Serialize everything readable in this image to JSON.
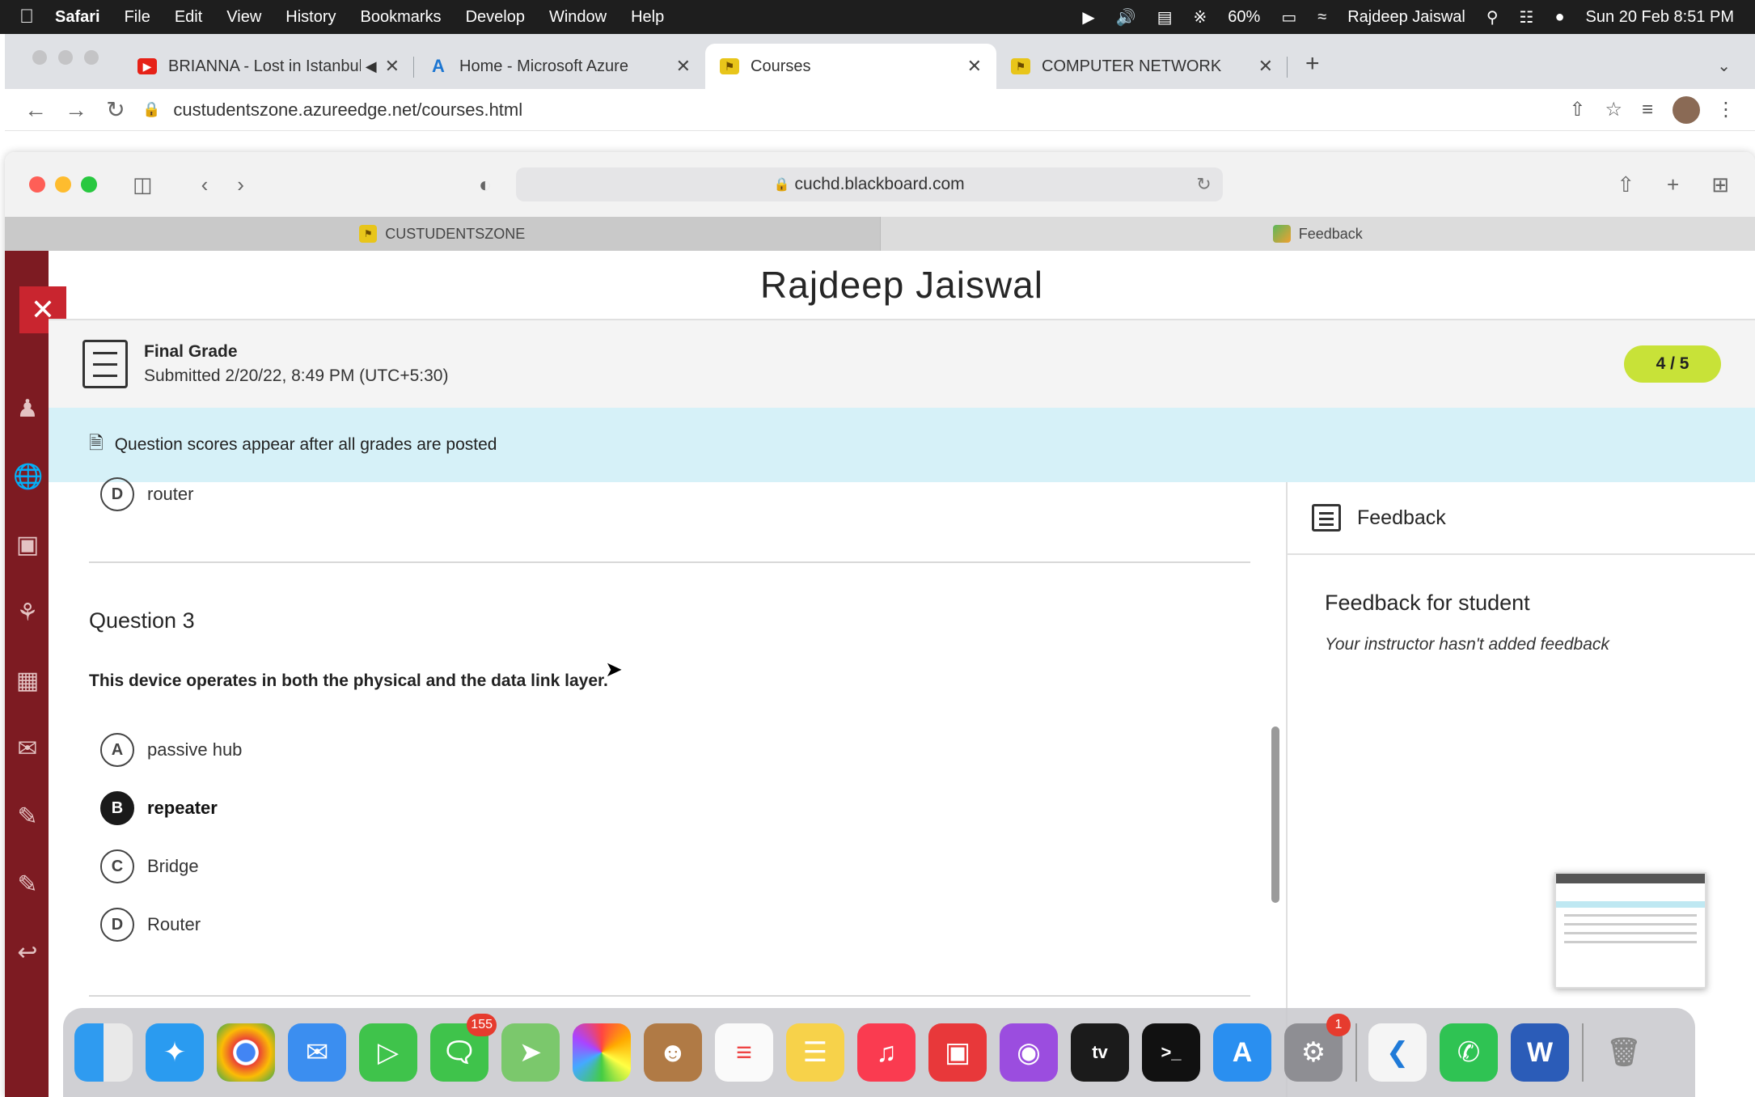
{
  "menubar": {
    "items": [
      "Safari",
      "File",
      "Edit",
      "View",
      "History",
      "Bookmarks",
      "Develop",
      "Window",
      "Help"
    ],
    "battery": "60%",
    "user": "Rajdeep Jaiswal",
    "datetime": "Sun 20 Feb  8:51 PM"
  },
  "chrome": {
    "tabs": [
      {
        "title": "BRIANNA - Lost in Istanbul",
        "color": "#e62117",
        "fav": "▶"
      },
      {
        "title": "Home - Microsoft Azure",
        "color": "#1c76d2",
        "fav": "A"
      },
      {
        "title": "Courses",
        "color": "#e8c51a",
        "fav": "⚑"
      },
      {
        "title": "COMPUTER NETWORK",
        "color": "#e8c51a",
        "fav": "⚑"
      }
    ],
    "url": "custudentszone.azureedge.net/courses.html"
  },
  "safari": {
    "url": "cuchd.blackboard.com",
    "tabs": [
      {
        "title": "CUSTUDENTSZONE"
      },
      {
        "title": "Feedback"
      }
    ]
  },
  "page": {
    "student_name": "Rajdeep Jaiswal",
    "grade_label": "Final Grade",
    "submitted": "Submitted 2/20/22, 8:49 PM (UTC+5:30)",
    "grade_value": "4 / 5",
    "notice": "Question scores appear after all grades are posted",
    "prev_option": {
      "letter": "D",
      "text": "router"
    },
    "question": {
      "title": "Question 3",
      "text": "This device operates in both the physical and the data link layer.",
      "options": [
        {
          "letter": "A",
          "text": "passive hub",
          "selected": false
        },
        {
          "letter": "B",
          "text": "repeater",
          "selected": true
        },
        {
          "letter": "C",
          "text": "Bridge",
          "selected": false
        },
        {
          "letter": "D",
          "text": "Router",
          "selected": false
        }
      ]
    }
  },
  "feedback": {
    "header": "Feedback",
    "subheader": "Feedback for student",
    "note": "Your instructor hasn't added feedback"
  },
  "dock": {
    "messages_badge": "155",
    "settings_badge": "1"
  },
  "colors": {
    "rail": "#7d1b22",
    "grade_pill": "#c8e238",
    "notice_bg": "#d6f1f8"
  }
}
